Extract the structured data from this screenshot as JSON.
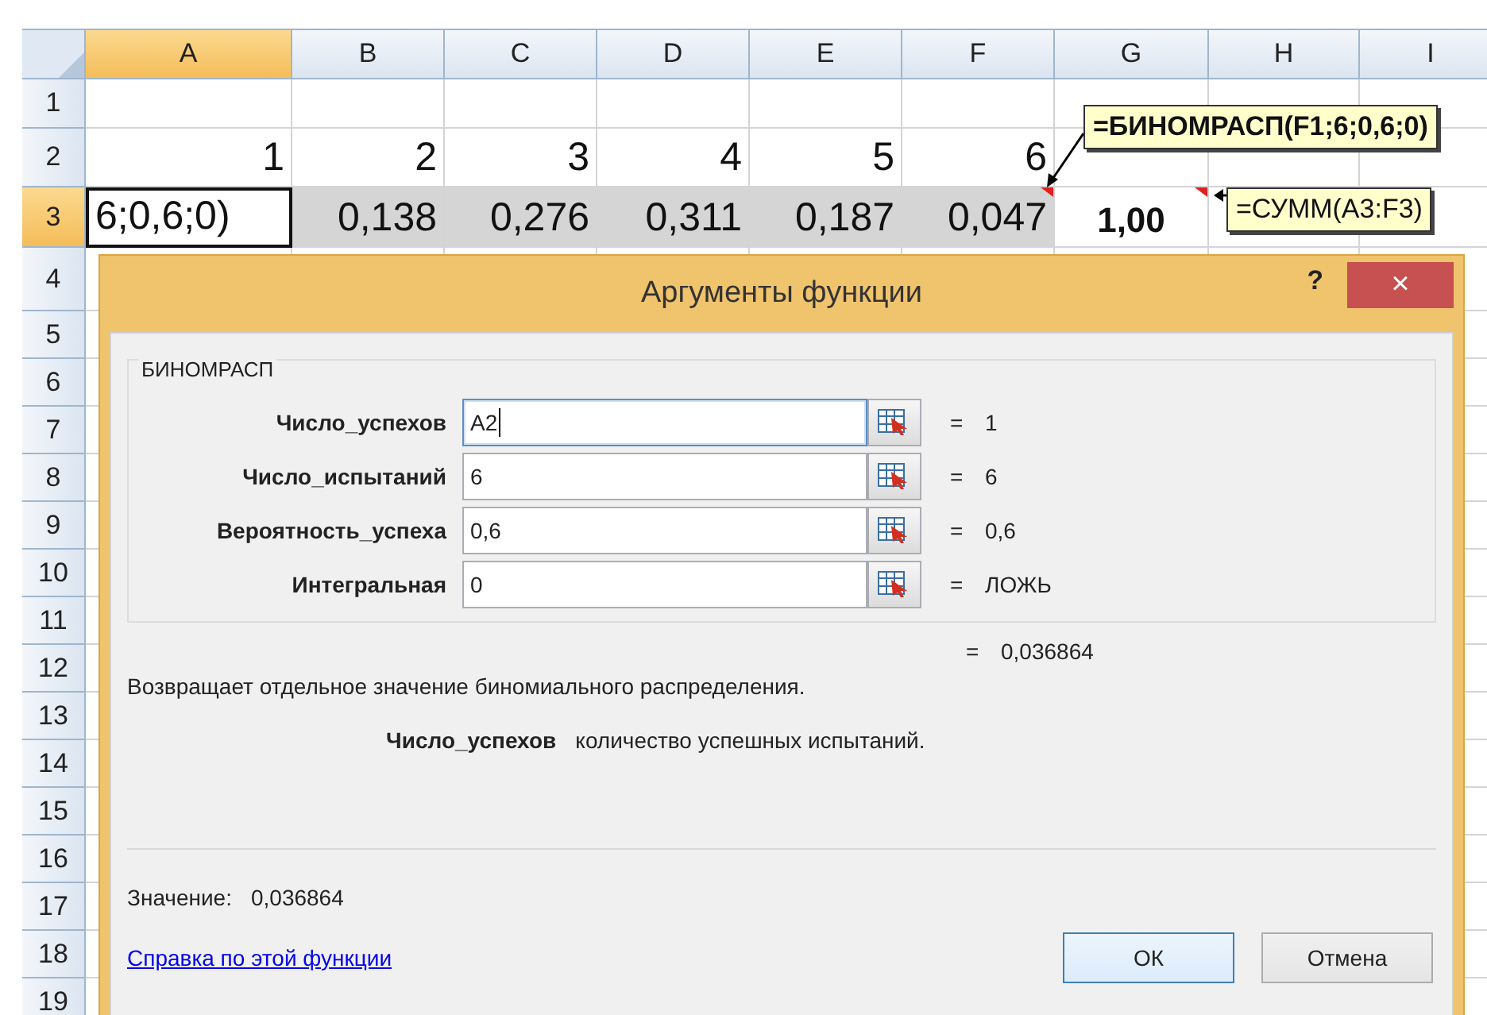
{
  "sheet": {
    "columns": [
      {
        "label": "A",
        "selected": true
      },
      {
        "label": "B",
        "selected": false
      },
      {
        "label": "C",
        "selected": false
      },
      {
        "label": "D",
        "selected": false
      },
      {
        "label": "E",
        "selected": false
      },
      {
        "label": "F",
        "selected": false
      },
      {
        "label": "G",
        "selected": false
      },
      {
        "label": "H",
        "selected": false
      },
      {
        "label": "I",
        "selected": false
      }
    ],
    "rows": [
      {
        "label": "1",
        "selected": false,
        "cells": []
      },
      {
        "label": "2",
        "selected": false,
        "cells": [
          {
            "text": "1",
            "selected": false,
            "active": false,
            "bold": false
          },
          {
            "text": "2",
            "selected": false,
            "active": false,
            "bold": false
          },
          {
            "text": "3",
            "selected": false,
            "active": false,
            "bold": false
          },
          {
            "text": "4",
            "selected": false,
            "active": false,
            "bold": false
          },
          {
            "text": "5",
            "selected": false,
            "active": false,
            "bold": false
          },
          {
            "text": "6",
            "selected": false,
            "active": false,
            "bold": false
          }
        ]
      },
      {
        "label": "3",
        "selected": true,
        "cells": [
          {
            "text": "6;0,6;0)",
            "selected": false,
            "active": true,
            "bold": false
          },
          {
            "text": "0,138",
            "selected": true,
            "active": false,
            "bold": false
          },
          {
            "text": "0,276",
            "selected": true,
            "active": false,
            "bold": false
          },
          {
            "text": "0,311",
            "selected": true,
            "active": false,
            "bold": false
          },
          {
            "text": "0,187",
            "selected": true,
            "active": false,
            "bold": false
          },
          {
            "text": "0,047",
            "selected": true,
            "active": false,
            "bold": false
          },
          {
            "text": "1,00",
            "selected": false,
            "active": false,
            "bold": true
          }
        ]
      },
      {
        "label": "4",
        "selected": false,
        "cells": []
      },
      {
        "label": "5",
        "selected": false,
        "cells": []
      },
      {
        "label": "6",
        "selected": false,
        "cells": []
      },
      {
        "label": "7",
        "selected": false,
        "cells": []
      },
      {
        "label": "8",
        "selected": false,
        "cells": []
      },
      {
        "label": "9",
        "selected": false,
        "cells": []
      },
      {
        "label": "10",
        "selected": false,
        "cells": []
      },
      {
        "label": "11",
        "selected": false,
        "cells": []
      },
      {
        "label": "12",
        "selected": false,
        "cells": []
      },
      {
        "label": "13",
        "selected": false,
        "cells": []
      },
      {
        "label": "14",
        "selected": false,
        "cells": []
      },
      {
        "label": "15",
        "selected": false,
        "cells": []
      },
      {
        "label": "16",
        "selected": false,
        "cells": []
      },
      {
        "label": "17",
        "selected": false,
        "cells": []
      },
      {
        "label": "18",
        "selected": false,
        "cells": []
      },
      {
        "label": "19",
        "selected": false,
        "cells": []
      }
    ]
  },
  "callouts": [
    {
      "text": "=БИНОМРАСП(F1;6;0,6;0)",
      "bold": true
    },
    {
      "text": "=СУММ(A3:F3)",
      "bold": false
    }
  ],
  "dialog": {
    "title": "Аргументы функции",
    "help": "?",
    "close": "×",
    "group_title": "БИНОМРАСП",
    "arguments": [
      {
        "label": "Число_успехов",
        "value": "A2",
        "focused": true,
        "sign": "=",
        "result": "1"
      },
      {
        "label": "Число_испытаний",
        "value": "6",
        "focused": false,
        "sign": "=",
        "result": "6"
      },
      {
        "label": "Вероятность_успеха",
        "value": "0,6",
        "focused": false,
        "sign": "=",
        "result": "0,6"
      },
      {
        "label": "Интегральная",
        "value": "0",
        "focused": false,
        "sign": "=",
        "result": "ЛОЖЬ"
      }
    ],
    "total": {
      "sign": "=",
      "value": "0,036864"
    },
    "description": "Возвращает отдельное значение биномиального распределения.",
    "argument_help": {
      "name": "Число_успехов",
      "text": "количество успешных испытаний."
    },
    "value_label": "Значение:",
    "value": "0,036864",
    "help_link": "Справка по этой функции",
    "buttons": [
      {
        "label": "ОК",
        "default": true
      },
      {
        "label": "Отмена",
        "default": false
      }
    ]
  }
}
